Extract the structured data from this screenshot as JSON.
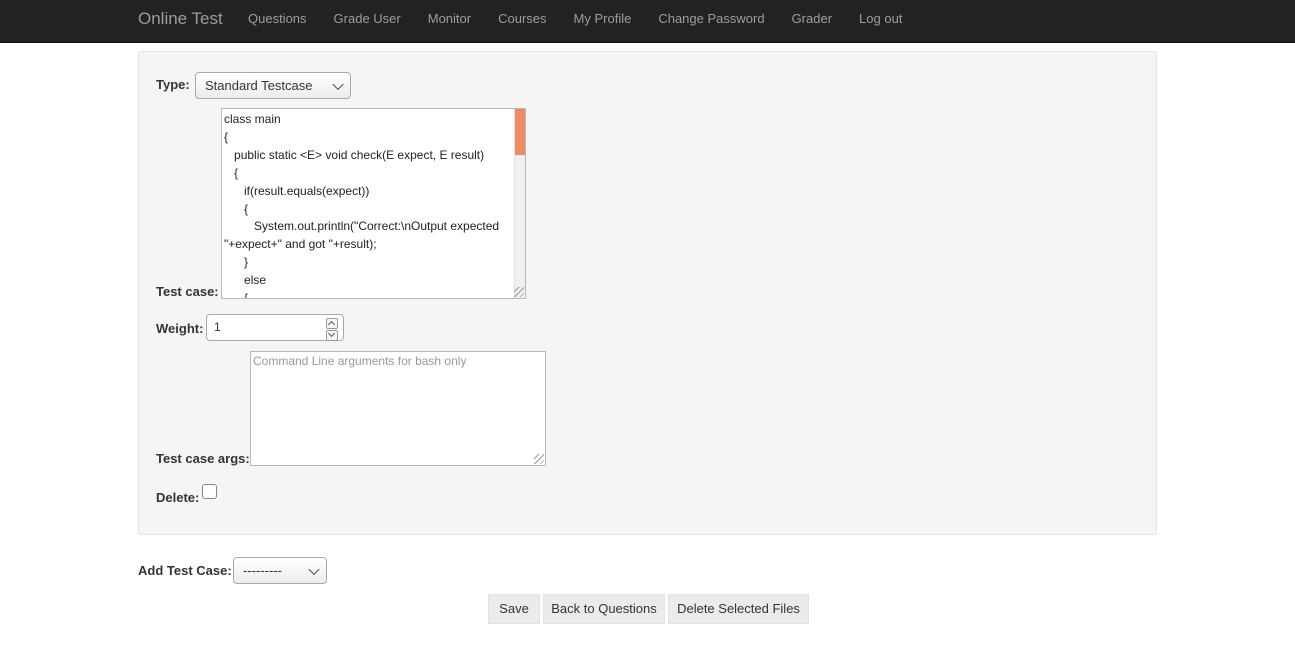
{
  "navbar": {
    "brand": "Online Test",
    "items": [
      "Questions",
      "Grade User",
      "Monitor",
      "Courses",
      "My Profile",
      "Change Password",
      "Grader",
      "Log out"
    ]
  },
  "form": {
    "type_label": "Type:",
    "type_value": "Standard Testcase",
    "testcase_label": "Test case:",
    "testcase_code": "class main\n{\n   public static <E> void check(E expect, E result)\n   {\n      if(result.equals(expect))\n      {\n         System.out.println(\"Correct:\\nOutput expected \"+expect+\" and got \"+result);\n      }\n      else\n      {",
    "weight_label": "Weight:",
    "weight_value": "1",
    "args_label": "Test case args:",
    "args_placeholder": "Command Line arguments for bash only",
    "delete_label": "Delete:"
  },
  "add_testcase": {
    "label": "Add Test Case:",
    "value": "---------"
  },
  "buttons": {
    "save": "Save",
    "back": "Back to Questions",
    "delete_files": "Delete Selected Files"
  },
  "colors": {
    "navbar_bg": "#222222",
    "scroll_thumb": "#ef8a63"
  }
}
